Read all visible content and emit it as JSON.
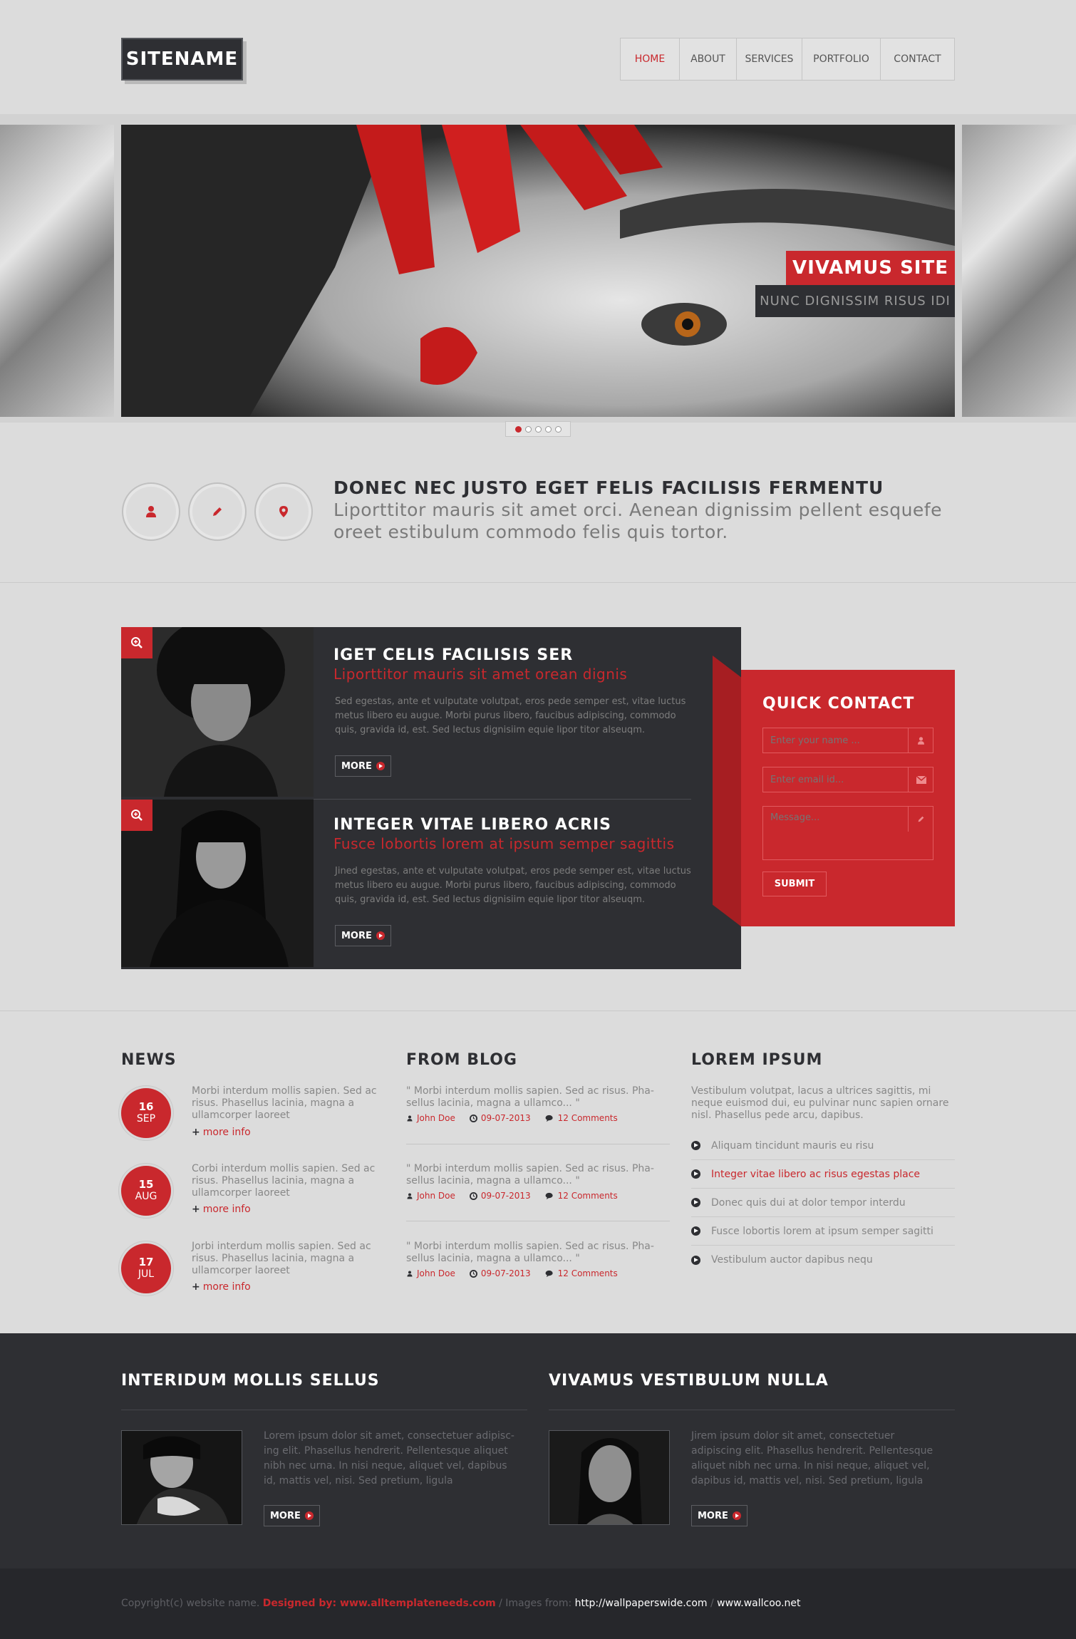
{
  "header": {
    "logo": "SITENAME",
    "nav": [
      "HOME",
      "ABOUT",
      "SERVICES",
      "PORTFOLIO",
      "CONTACT"
    ]
  },
  "slider": {
    "caption": "VIVAMUS SITE",
    "subcaption": "NUNC DIGNISSIM RISUS IDI",
    "slide_count": 5,
    "active_slide": 1
  },
  "intro": {
    "title": "DONEC NEC JUSTO EGET FELIS FACILISIS FERMENTU",
    "text": "Liporttitor mauris sit amet orci. Aenean dignissim pellent esquefe oreet estibulum commodo felis quis tortor.",
    "icons": [
      "user-icon",
      "pencil-icon",
      "map-pin-icon"
    ]
  },
  "features": [
    {
      "title": "IGET CELIS FACILISIS SER",
      "subtitle": "Liporttitor mauris sit amet orean dignis",
      "text": "Sed egestas, ante et vulputate volutpat, eros pede semper est, vitae luctus metus libero eu augue. Morbi purus libero, faucibus adipiscing, commodo quis, gravida id, est. Sed lectus dignisiim equie lipor titor alseuqm.",
      "more": "MORE"
    },
    {
      "title": "INTEGER VITAE LIBERO ACRIS",
      "subtitle": "Fusce lobortis lorem at ipsum semper sagittis",
      "text": "Jined egestas, ante et vulputate volutpat, eros pede semper est, vitae luctus metus libero eu augue. Morbi purus libero, faucibus adipiscing, commodo quis, gravida id, est. Sed lectus dignisiim equie lipor titor alseuqm.",
      "more": "MORE"
    }
  ],
  "quick_contact": {
    "title": "QUICK CONTACT",
    "name_placeholder": "Enter your name ...",
    "email_placeholder": "Enter email id...",
    "message_placeholder": "Message...",
    "submit": "SUBMIT"
  },
  "news": {
    "title": "NEWS",
    "items": [
      {
        "day": "16",
        "month": "SEP",
        "text": "Morbi interdum mollis sapien. Sed ac risus. Phasellus lacinia, magna a ullamcorper laoreet",
        "more": "more info"
      },
      {
        "day": "15",
        "month": "AUG",
        "text": "Corbi interdum mollis sapien. Sed ac risus. Phasellus lacinia, magna a ullamcorper laoreet",
        "more": "more info"
      },
      {
        "day": "17",
        "month": "JUL",
        "text": "Jorbi interdum mollis sapien. Sed ac risus. Phasellus lacinia, magna a ullamcorper laoreet",
        "more": "more info"
      }
    ]
  },
  "blog": {
    "title": "FROM BLOG",
    "items": [
      {
        "quote": "\" Morbi interdum mollis sapien. Sed ac risus. Pha-sellus lacinia, magna a ullamco... \"",
        "author": "John Doe",
        "date": "09-07-2013",
        "comments": "12 Comments"
      },
      {
        "quote": "\" Morbi interdum mollis sapien. Sed ac risus. Pha-sellus lacinia, magna a ullamco... \"",
        "author": "John Doe",
        "date": "09-07-2013",
        "comments": "12 Comments"
      },
      {
        "quote": "\" Morbi interdum mollis sapien. Sed ac risus. Pha-sellus lacinia, magna a ullamco... \"",
        "author": "John Doe",
        "date": "09-07-2013",
        "comments": "12 Comments"
      }
    ]
  },
  "lorem": {
    "title": "LOREM IPSUM",
    "intro": "Vestibulum volutpat, lacus a ultrices sagittis, mi neque euismod dui, eu pulvinar nunc sapien ornare nisl. Phasellus pede arcu, dapibus.",
    "items": [
      "Aliquam tincidunt mauris eu risu",
      "Integer vitae libero ac risus egestas place",
      "Donec quis dui at dolor tempor interdu",
      "Fusce lobortis lorem at ipsum semper sagitti",
      "Vestibulum auctor dapibus nequ"
    ]
  },
  "footer_blocks": [
    {
      "title": "INTERIDUM MOLLIS SELLUS",
      "text": "Lorem ipsum dolor sit amet, consectetuer adipisc-ing elit. Phasellus hendrerit. Pellentesque aliquet nibh nec urna. In nisi neque, aliquet vel, dapibus id, mattis vel, nisi. Sed pretium, ligula",
      "more": "MORE"
    },
    {
      "title": "VIVAMUS VESTIBULUM NULLA",
      "text": "Jirem ipsum dolor sit amet, consectetuer adipiscing elit. Phasellus hendrerit. Pellentesque aliquet nibh nec urna. In nisi neque, aliquet vel, dapibus id, mattis vel, nisi. Sed pretium, ligula",
      "more": "MORE"
    }
  ],
  "copyright": {
    "prefix": "Copyright(c) website name.",
    "designed": "Designed by: www.alltemplateneeds.com",
    "images_from": "/ Images from:",
    "site1": "http://wallpaperswide.com",
    "sep": "/",
    "site2": "www.wallcoo.net"
  },
  "colors": {
    "accent": "#c9282d",
    "dark": "#2e2f33",
    "background": "#dcdcdc"
  }
}
